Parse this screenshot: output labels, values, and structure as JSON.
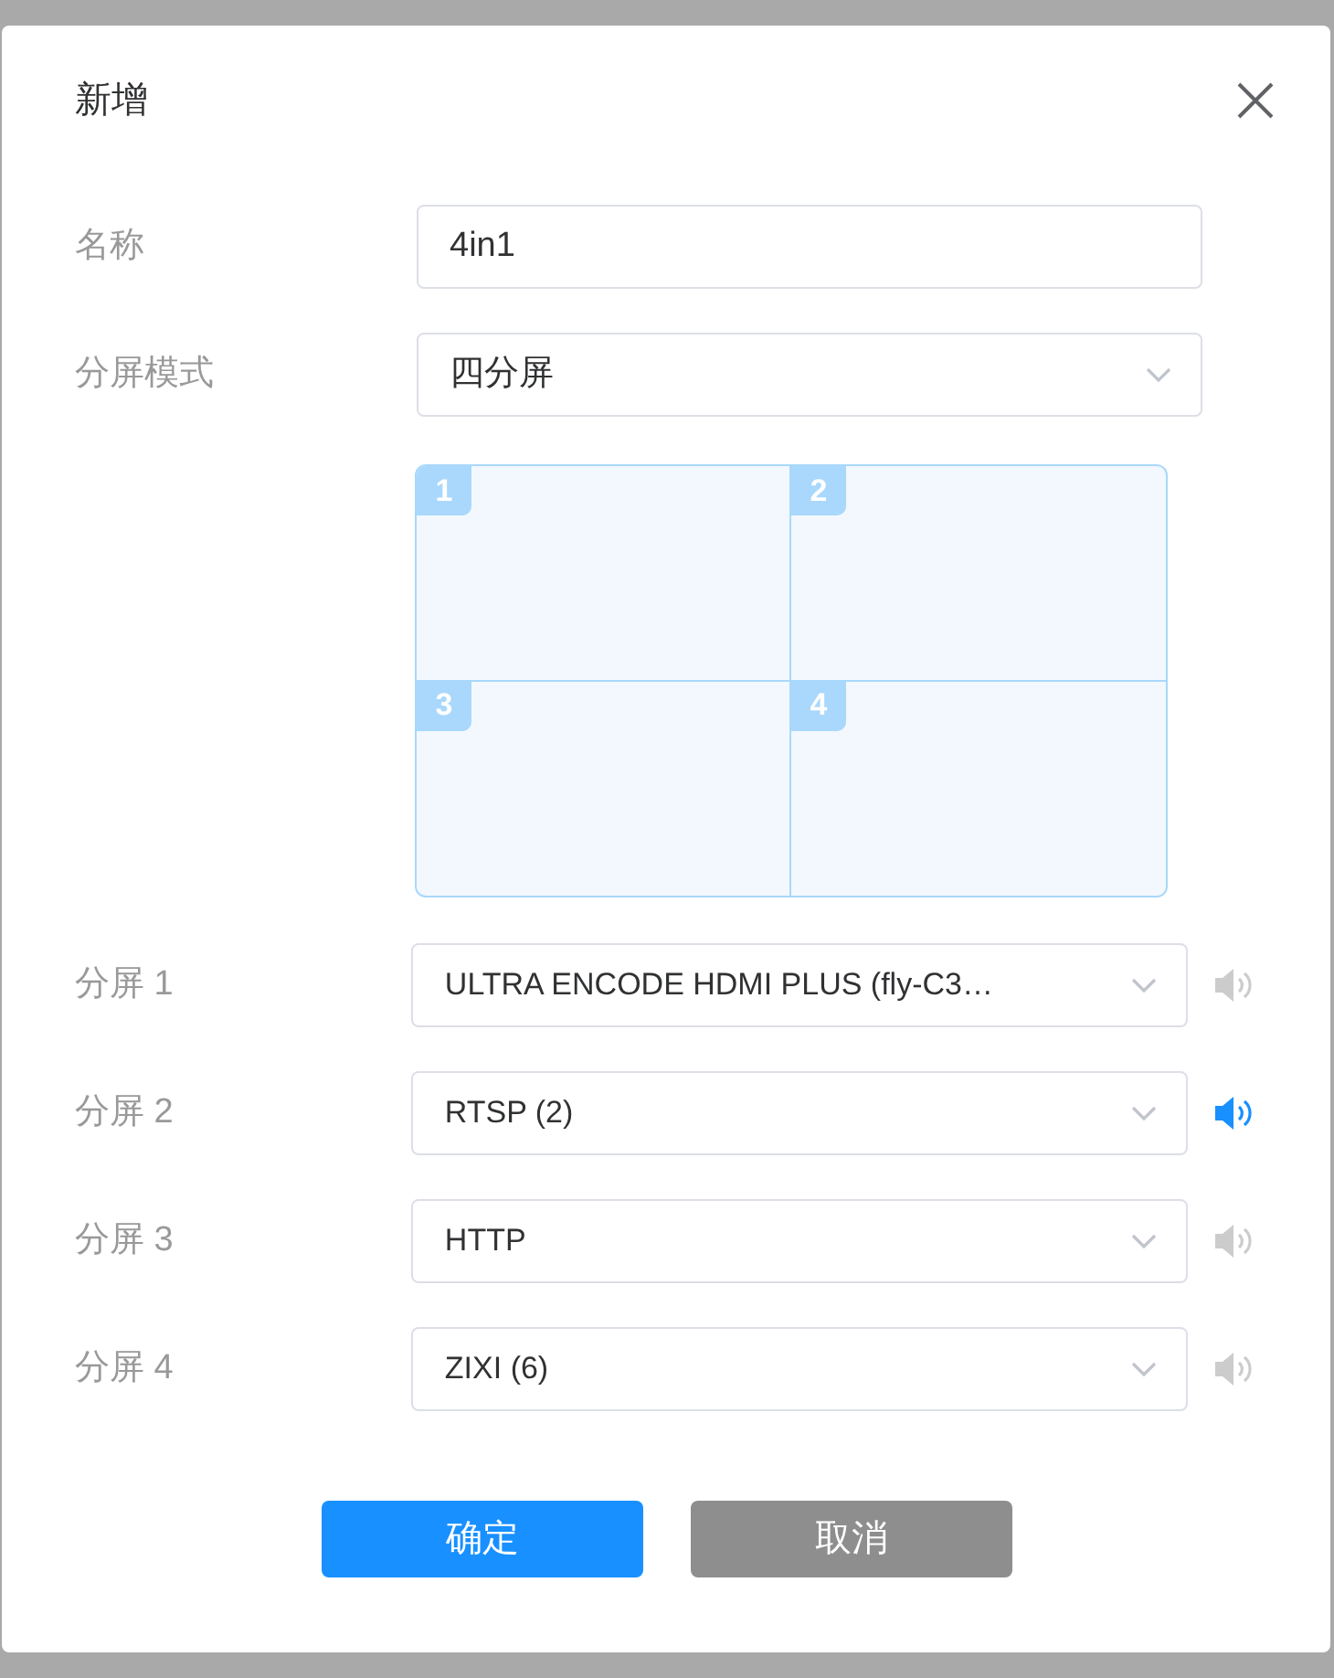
{
  "dialog": {
    "title": "新增"
  },
  "fields": [
    {
      "label": "名称",
      "kind": "input",
      "value": "4in1"
    },
    {
      "label": "分屏模式",
      "kind": "select",
      "value": "四分屏"
    }
  ],
  "layout_preview": {
    "cells": [
      "1",
      "2",
      "3",
      "4"
    ]
  },
  "screens": [
    {
      "label": "分屏 1",
      "source": "ULTRA ENCODE HDMI PLUS (fly-C3…",
      "audio_on": false
    },
    {
      "label": "分屏 2",
      "source": "RTSP (2)",
      "audio_on": true
    },
    {
      "label": "分屏 3",
      "source": "HTTP",
      "audio_on": false
    },
    {
      "label": "分屏 4",
      "source": "ZIXI (6)",
      "audio_on": false
    }
  ],
  "buttons": [
    {
      "label": "确定",
      "kind": "primary"
    },
    {
      "label": "取消",
      "kind": "secondary"
    }
  ]
}
